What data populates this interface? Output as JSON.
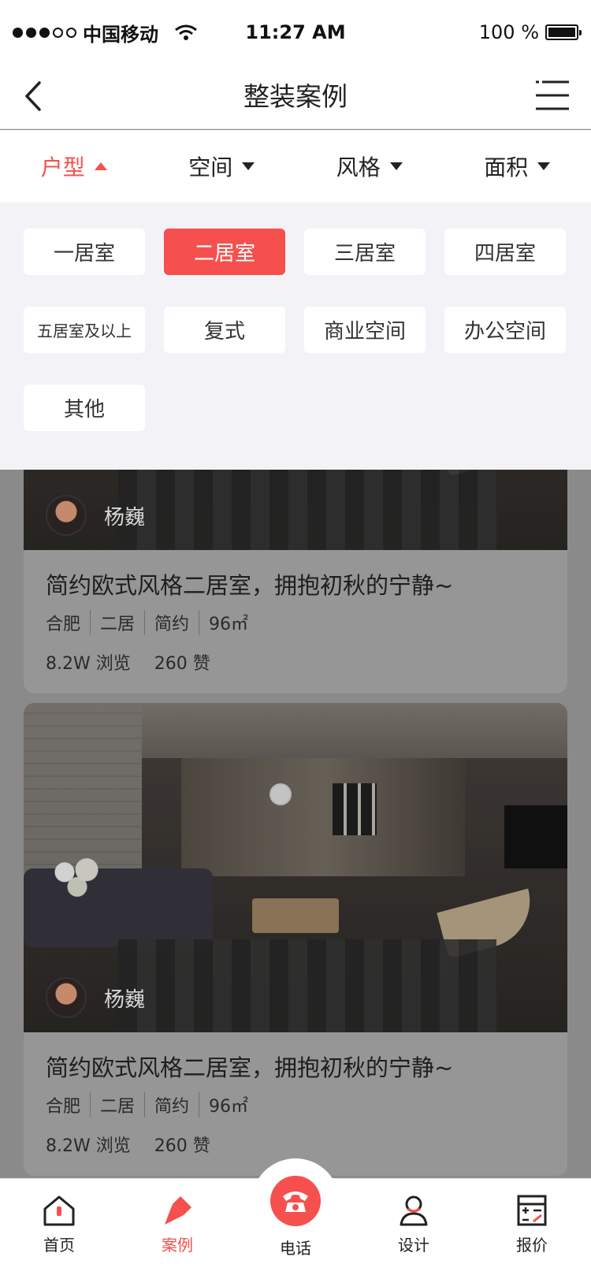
{
  "status_bar": {
    "carrier": "中国移动",
    "time": "11:27 AM",
    "battery": "100 %",
    "battery_level": 1.0,
    "signal_bars_filled": 3,
    "signal_bars_total": 5
  },
  "nav": {
    "title": "整装案例",
    "back_icon": "chevron-left-icon",
    "menu_icon": "list-menu-icon"
  },
  "filters": [
    {
      "label": "户型",
      "active": true
    },
    {
      "label": "空间",
      "active": false
    },
    {
      "label": "风格",
      "active": false
    },
    {
      "label": "面积",
      "active": false
    }
  ],
  "room_options": [
    {
      "label": "一居室",
      "selected": false
    },
    {
      "label": "二居室",
      "selected": true
    },
    {
      "label": "三居室",
      "selected": false
    },
    {
      "label": "四居室",
      "selected": false
    },
    {
      "label": "五居室及以上",
      "selected": false
    },
    {
      "label": "复式",
      "selected": false
    },
    {
      "label": "商业空间",
      "selected": false
    },
    {
      "label": "办公空间",
      "selected": false
    },
    {
      "label": "其他",
      "selected": false
    }
  ],
  "cases": [
    {
      "designer": "杨巍",
      "title": "简约欧式风格二居室，拥抱初秋的宁静~",
      "tags": [
        "合肥",
        "二居",
        "简约",
        "96㎡"
      ],
      "views": "8.2W 浏览",
      "likes": "260 赞"
    },
    {
      "designer": "杨巍",
      "title": "简约欧式风格二居室，拥抱初秋的宁静~",
      "tags": [
        "合肥",
        "二居",
        "简约",
        "96㎡"
      ],
      "views": "8.2W 浏览",
      "likes": "260 赞"
    }
  ],
  "tabbar": {
    "items": [
      {
        "label": "首页",
        "icon": "home-icon",
        "active": false
      },
      {
        "label": "案例",
        "icon": "brush-icon",
        "active": true
      },
      {
        "label": "电话",
        "icon": "phone-icon",
        "active": false
      },
      {
        "label": "设计",
        "icon": "designer-icon",
        "active": false
      },
      {
        "label": "报价",
        "icon": "calculator-icon",
        "active": false
      }
    ]
  },
  "colors": {
    "accent": "#f5504e",
    "panel_bg": "#f3f3f7",
    "overlay_bg": "#8a8a8a"
  }
}
